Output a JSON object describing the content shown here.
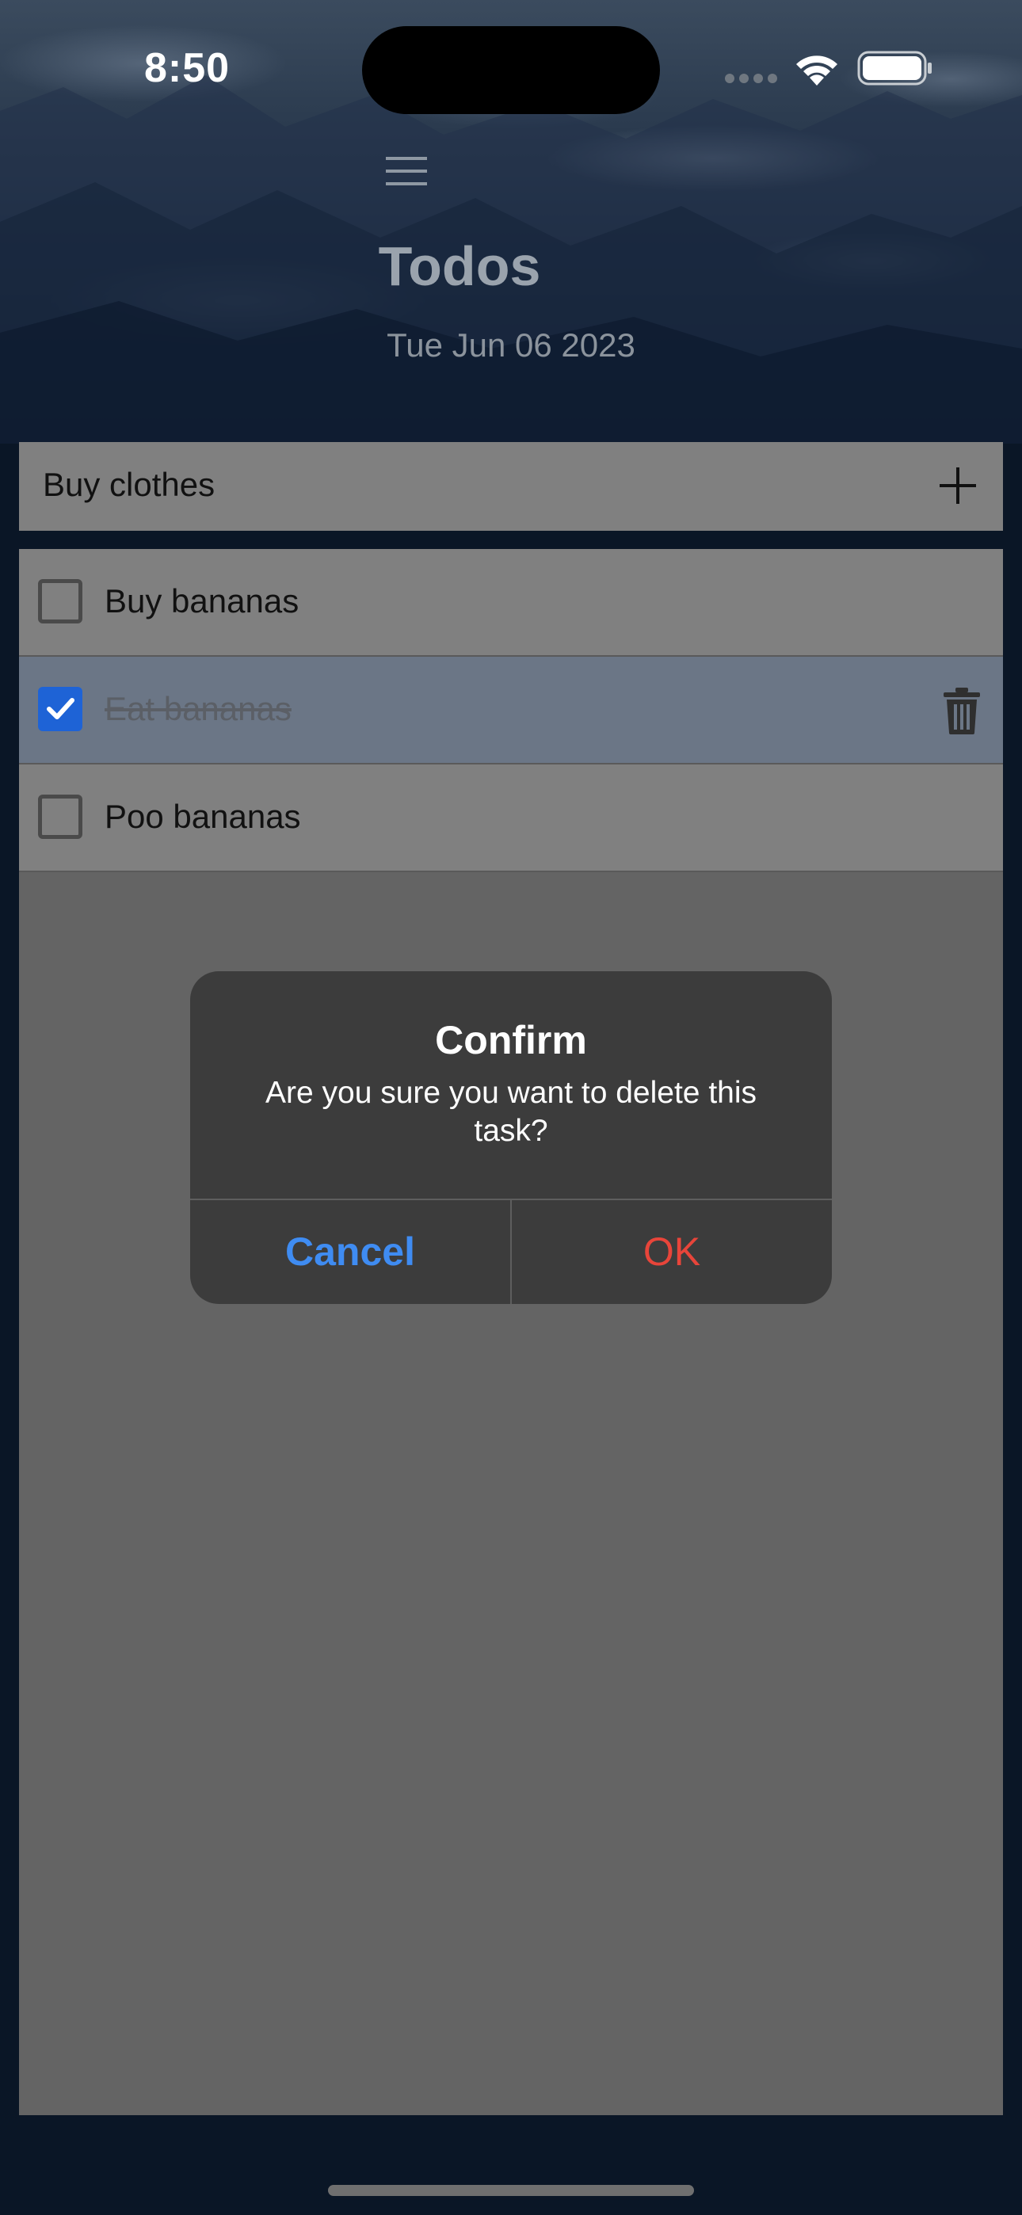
{
  "status_bar": {
    "time": "8:50",
    "icons": [
      "signal-icon",
      "wifi-icon",
      "battery-icon"
    ]
  },
  "header": {
    "menu_icon": "menu-icon",
    "title": "Todos",
    "date": "Tue Jun 06 2023"
  },
  "add_bar": {
    "input_value": "Buy clothes",
    "add_icon": "plus-icon"
  },
  "todos": [
    {
      "label": "Buy bananas",
      "checked": false
    },
    {
      "label": "Eat bananas",
      "checked": true,
      "selected": true
    },
    {
      "label": "Poo bananas",
      "checked": false
    }
  ],
  "dialog": {
    "title": "Confirm",
    "message": "Are you sure you want to delete this task?",
    "cancel_label": "Cancel",
    "ok_label": "OK"
  },
  "colors": {
    "checkbox_checked": "#1e63d6",
    "cancel": "#3f8cf2",
    "ok": "#e8453a"
  }
}
